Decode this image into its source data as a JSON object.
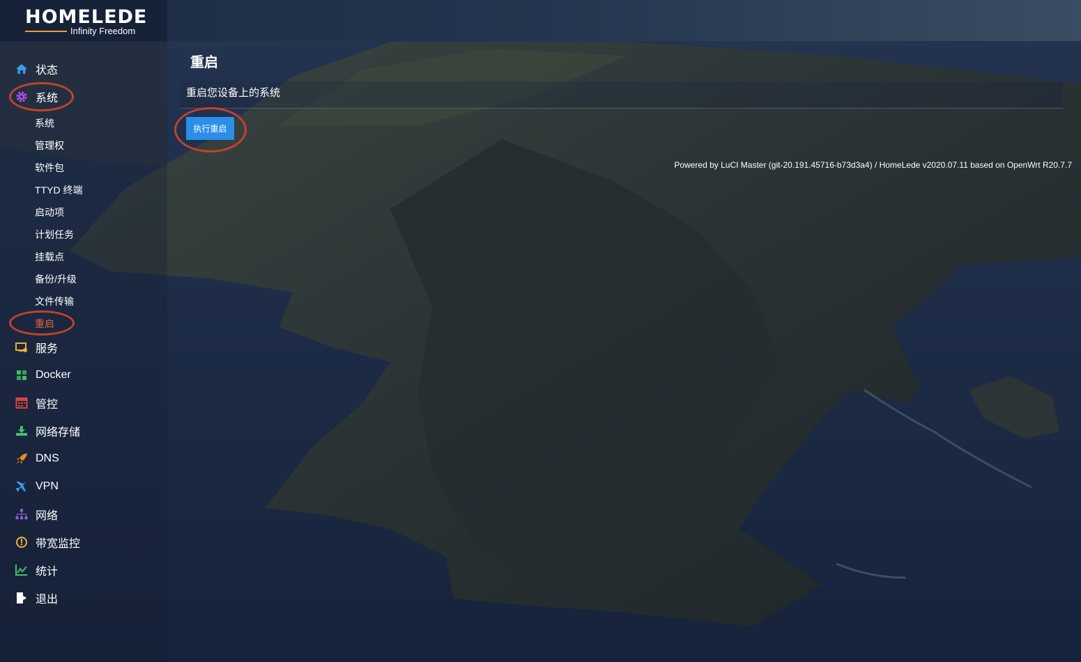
{
  "brand": {
    "logo_text": "HOMELEDE",
    "tagline": "Infinity Freedom"
  },
  "sidebar": {
    "items": [
      {
        "label": "状态",
        "icon": "home-icon",
        "color": "#3a9ee8"
      },
      {
        "label": "系统",
        "icon": "gear-icon",
        "color": "#b050e8"
      },
      {
        "label": "服务",
        "icon": "services-icon",
        "color": "#f0b030"
      },
      {
        "label": "Docker",
        "icon": "docker-icon",
        "color": "#3cc060"
      },
      {
        "label": "管控",
        "icon": "control-icon",
        "color": "#e04040"
      },
      {
        "label": "网络存储",
        "icon": "storage-icon",
        "color": "#40c070"
      },
      {
        "label": "DNS",
        "icon": "rocket-icon",
        "color": "#f08a20"
      },
      {
        "label": "VPN",
        "icon": "plane-icon",
        "color": "#3a9ee8"
      },
      {
        "label": "网络",
        "icon": "sitemap-icon",
        "color": "#9060e0"
      },
      {
        "label": "带宽监控",
        "icon": "gauge-icon",
        "color": "#f0b030"
      },
      {
        "label": "统计",
        "icon": "chart-icon",
        "color": "#40c070"
      },
      {
        "label": "退出",
        "icon": "logout-icon",
        "color": "#ffffff"
      }
    ],
    "system_subitems": [
      {
        "label": "系统"
      },
      {
        "label": "管理权"
      },
      {
        "label": "软件包"
      },
      {
        "label": "TTYD 终端"
      },
      {
        "label": "启动项"
      },
      {
        "label": "计划任务"
      },
      {
        "label": "挂载点"
      },
      {
        "label": "备份/升级"
      },
      {
        "label": "文件传输"
      },
      {
        "label": "重启",
        "active": true
      }
    ]
  },
  "main": {
    "title": "重启",
    "description": "重启您设备上的系统",
    "reboot_button": "执行重启"
  },
  "footer": {
    "text": "Powered by LuCI Master (git-20.191.45716-b73d3a4) / HomeLede v2020.07.11 based on OpenWrt R20.7.7"
  },
  "colors": {
    "accent": "#2b8ee8",
    "active_item": "#e0663c",
    "highlight_ring": "#c0432c"
  }
}
